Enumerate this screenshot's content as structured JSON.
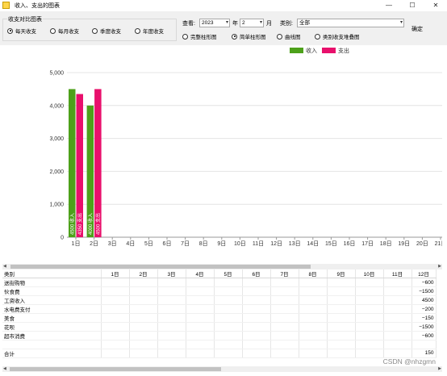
{
  "window": {
    "title": "收入、支出的图表",
    "controls": [
      "—",
      "☐",
      "✕"
    ]
  },
  "toolbar": {
    "group_title": "收支对比图表",
    "period_options": [
      {
        "label": "每天收支",
        "selected": true
      },
      {
        "label": "每月收支",
        "selected": false
      },
      {
        "label": "季度收支",
        "selected": false
      },
      {
        "label": "年度收支",
        "selected": false
      }
    ],
    "view_label": "查看:",
    "year_value": "2023",
    "year_unit": "年",
    "month_value": "2",
    "month_unit": "月",
    "category_label": "类别:",
    "category_value": "全部",
    "chart_type_options": [
      {
        "label": "完整柱形图",
        "selected": false
      },
      {
        "label": "简单柱形图",
        "selected": true
      },
      {
        "label": "曲线图",
        "selected": false
      },
      {
        "label": "类别收支堆叠图",
        "selected": false
      }
    ],
    "confirm_label": "确定"
  },
  "chart_data": {
    "type": "bar",
    "categories": [
      "1日",
      "2日",
      "3日",
      "4日",
      "5日",
      "6日",
      "7日",
      "8日",
      "9日",
      "10日",
      "11日",
      "12日",
      "13日",
      "14日",
      "15日",
      "16日",
      "17日",
      "18日",
      "19日",
      "20日",
      "21日"
    ],
    "series": [
      {
        "name": "收入",
        "color": "#4da11a",
        "values": [
          4500,
          4000,
          null,
          null,
          null,
          null,
          null,
          null,
          null,
          null,
          null,
          null,
          null,
          null,
          null,
          null,
          null,
          null,
          null,
          null,
          null
        ],
        "bar_labels": [
          "4500 收入",
          "4000 收入"
        ]
      },
      {
        "name": "支出",
        "color": "#e8106c",
        "values": [
          4350,
          4500,
          null,
          null,
          null,
          null,
          null,
          null,
          null,
          null,
          null,
          null,
          null,
          null,
          null,
          null,
          null,
          null,
          null,
          null,
          null
        ],
        "bar_labels": [
          "4350 支出",
          "4500 支出"
        ]
      }
    ],
    "ylim": [
      0,
      5000
    ],
    "yticks": [
      0,
      1000,
      2000,
      3000,
      4000,
      5000
    ],
    "ytick_labels": [
      "0",
      "1,000",
      "2,000",
      "3,000",
      "4,000",
      "5,000"
    ],
    "legend_position": "top-right",
    "grid": true
  },
  "table": {
    "columns": [
      "类别",
      "1日",
      "2日",
      "3日",
      "4日",
      "5日",
      "6日",
      "7日",
      "8日",
      "9日",
      "10日",
      "11日",
      "12日"
    ],
    "rows": [
      [
        "送街购物",
        "",
        "",
        "",
        "",
        "",
        "",
        "",
        "",
        "",
        "",
        "",
        "−600"
      ],
      [
        "伙食费",
        "",
        "",
        "",
        "",
        "",
        "",
        "",
        "",
        "",
        "",
        "",
        "−1500"
      ],
      [
        "工资收入",
        "",
        "",
        "",
        "",
        "",
        "",
        "",
        "",
        "",
        "",
        "",
        "4500"
      ],
      [
        "水电费支付",
        "",
        "",
        "",
        "",
        "",
        "",
        "",
        "",
        "",
        "",
        "",
        "−200"
      ],
      [
        "美食",
        "",
        "",
        "",
        "",
        "",
        "",
        "",
        "",
        "",
        "",
        "",
        "−150"
      ],
      [
        "花呗",
        "",
        "",
        "",
        "",
        "",
        "",
        "",
        "",
        "",
        "",
        "",
        "−1500"
      ],
      [
        "超市消费",
        "",
        "",
        "",
        "",
        "",
        "",
        "",
        "",
        "",
        "",
        "",
        "−600"
      ],
      [
        "",
        "",
        "",
        "",
        "",
        "",
        "",
        "",
        "",
        "",
        "",
        "",
        ""
      ],
      [
        "合计",
        "",
        "",
        "",
        "",
        "",
        "",
        "",
        "",
        "",
        "",
        "",
        "150"
      ]
    ]
  },
  "watermark": "CSDN @nhzgmn"
}
